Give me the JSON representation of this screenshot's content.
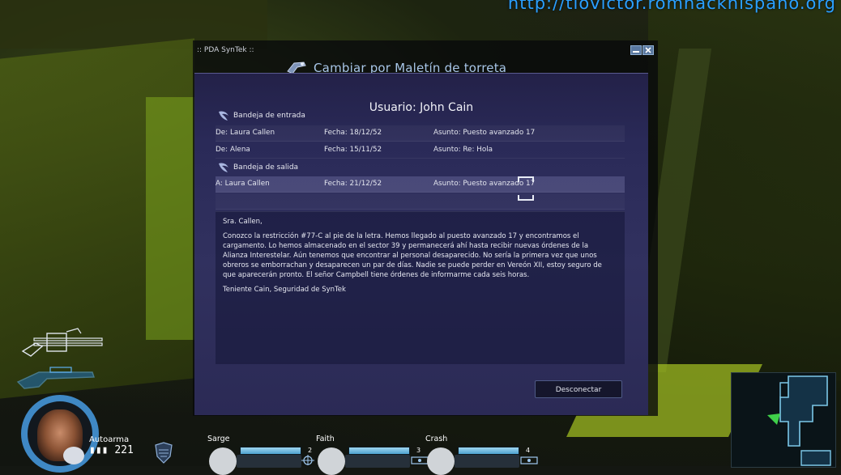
{
  "watermark": "http://tiovictor.romhackhispano.org",
  "pda": {
    "window_title": ":: PDA SynTek ::",
    "quest_banner": "Cambiar por Maletín de torreta",
    "user_title": "Usuario: John Cain",
    "inbox_label": "Bandeja de entrada",
    "outbox_label": "Bandeja de salida",
    "inbox": [
      {
        "from": "De: Laura Callen",
        "date": "Fecha: 18/12/52",
        "subject": "Asunto: Puesto avanzado 17"
      },
      {
        "from": "De: Alena",
        "date": "Fecha: 15/11/52",
        "subject": "Asunto: Re: Hola"
      }
    ],
    "outbox": [
      {
        "from": "A: Laura Callen",
        "date": "Fecha: 21/12/52",
        "subject": "Asunto: Puesto avanzado 17"
      }
    ],
    "message_body": [
      "Sra. Callen,",
      "Conozco la restricción #77-C al pie de la letra. Hemos llegado al puesto avanzado 17 y encontramos el cargamento. Lo hemos almacenado en el sector 39 y permanecerá ahí hasta recibir nuevas órdenes de la Alianza Interestelar. Aún tenemos que encontrar al personal desaparecido. No sería la primera vez que unos obreros se emborrachan y desaparecen un par de días. Nadie se puede perder en Vereón XII, estoy seguro de que aparecerán pronto. El señor Campbell tiene órdenes de informarme cada seis horas.",
      "Teniente Cain, Seguridad de SynTek"
    ],
    "disconnect_label": "Desconectar"
  },
  "hud": {
    "weapon_name": "Autoarma",
    "ammo": "221",
    "squad": [
      {
        "name": "Sarge",
        "count": "2"
      },
      {
        "name": "Faith",
        "count": "3"
      },
      {
        "name": "Crash",
        "count": "4"
      }
    ]
  },
  "colors": {
    "panel": "#2a2a58",
    "accent_blue": "#3f88c4",
    "hud_bar": "#4ea2d0",
    "environment_green": "#7da51d",
    "watermark": "#2aa0ff"
  }
}
